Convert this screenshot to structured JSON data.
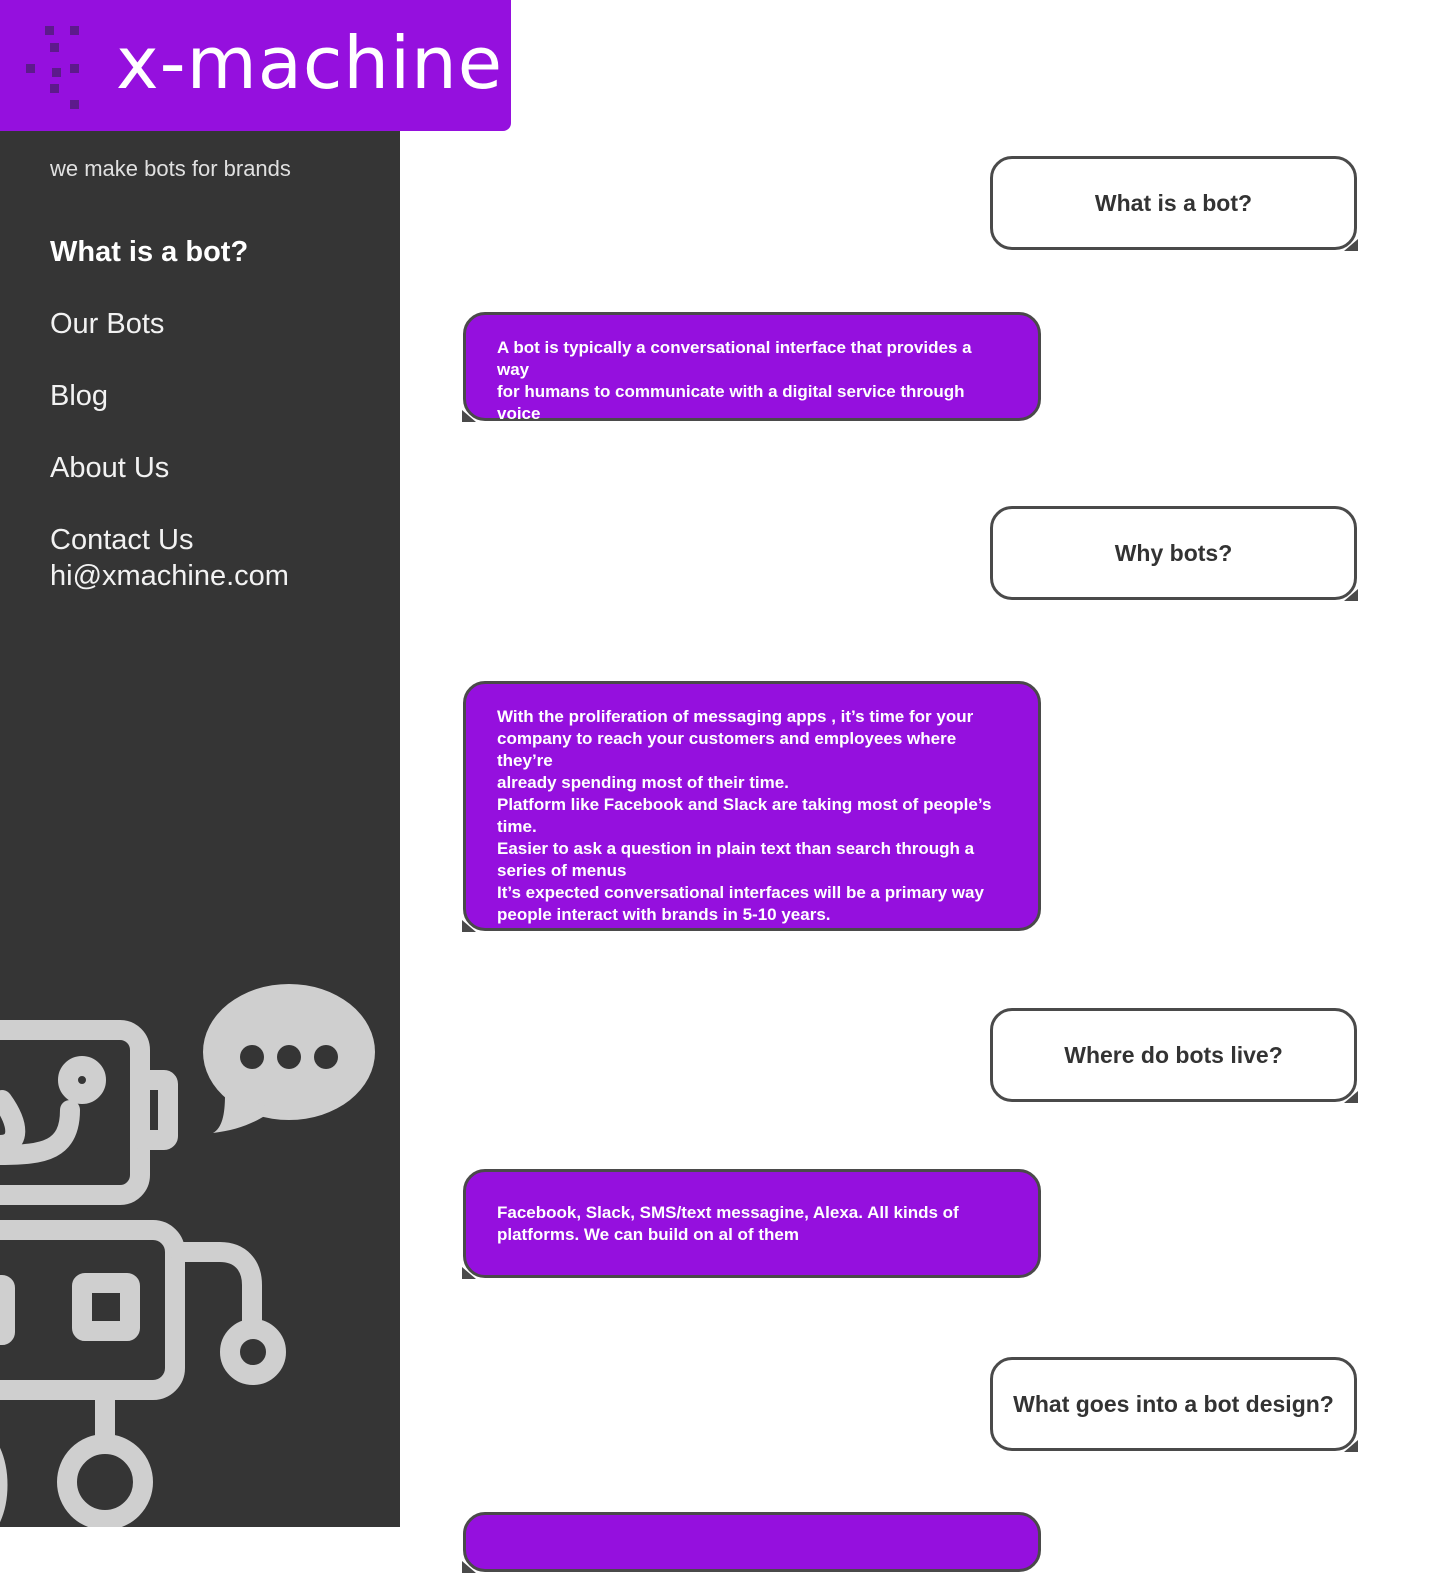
{
  "brand": {
    "name": "x-machine",
    "tagline": "we make bots for brands",
    "color": "#9510de"
  },
  "nav": {
    "items": [
      {
        "label": "What is a bot?",
        "active": true
      },
      {
        "label": "Our Bots"
      },
      {
        "label": "Blog"
      },
      {
        "label": "About Us"
      },
      {
        "label": "Contact Us"
      }
    ],
    "email": "hi@xmachine.com"
  },
  "conversation": [
    {
      "type": "question",
      "text": "What is a bot?"
    },
    {
      "type": "answer",
      "text": "A bot is typically a conversational interface that provides a way\nfor humans to communicate with a digital service through voice\nand text."
    },
    {
      "type": "question",
      "text": "Why bots?"
    },
    {
      "type": "answer",
      "text": "With the proliferation of messaging apps , it’s time for your\ncompany to reach your customers and employees where they’re\nalready spending most of their time.\nPlatform like Facebook and Slack are taking most of people’s\ntime.\nEasier to ask a question in plain text than search through a\nseries of menus\nIt’s expected conversational interfaces will be a primary way\npeople interact with brands in 5-10 years."
    },
    {
      "type": "question",
      "text": "Where do bots live?"
    },
    {
      "type": "answer",
      "text": "Facebook, Slack, SMS/text messagine, Alexa. All kinds of\nplatforms. We can build on al of them"
    },
    {
      "type": "question",
      "text": "What goes into a bot design?"
    },
    {
      "type": "answer",
      "text": ""
    }
  ],
  "icons": [
    "logo-mark-icon",
    "robot-illustration-icon",
    "speech-bubble-icon"
  ]
}
